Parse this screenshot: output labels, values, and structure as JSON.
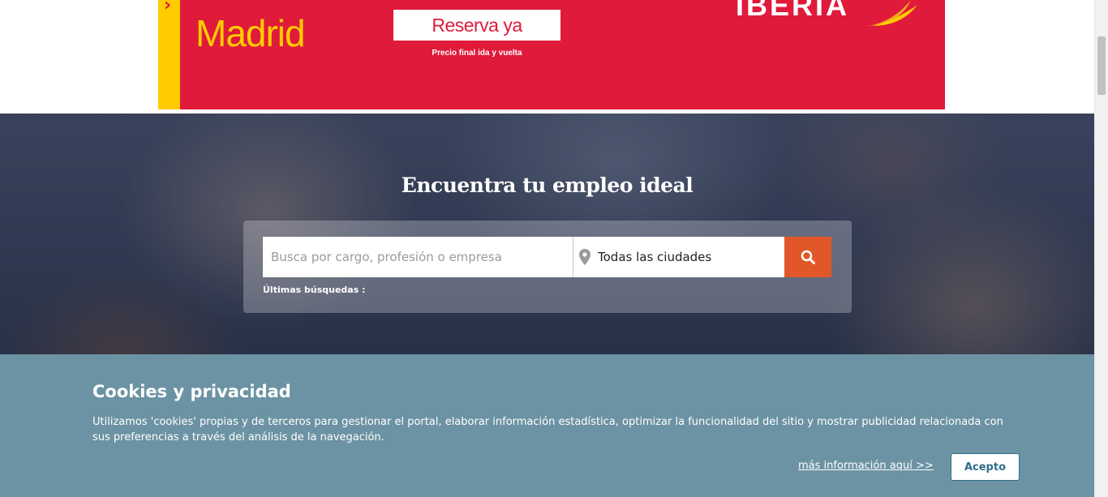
{
  "ad": {
    "chevron": "›",
    "city": "Madrid",
    "cta": "Reserva ya",
    "note": "Precio final ida y vuelta",
    "brand": "IBERIA",
    "colors": {
      "background": "#e01a3b",
      "accent": "#ffcc00"
    }
  },
  "hero": {
    "title": "Encuentra tu empleo ideal",
    "search": {
      "placeholder": "Busca por cargo, profesión o empresa",
      "value": "",
      "city_value": "Todas las ciudades",
      "city_icon": "map-pin-icon",
      "button_icon": "search-icon"
    },
    "recent_label": "Últimas búsquedas :"
  },
  "cookies": {
    "title": "Cookies y privacidad",
    "text": "Utilizamos 'cookies' propias y de terceros para gestionar el portal, elaborar información estadística, optimizar la funcionalidad del sitio y mostrar publicidad relacionada con sus preferencias a través del análisis de la navegación.",
    "more_link": "más información aquí >>",
    "accept": "Acepto"
  },
  "colors": {
    "search_button": "#e2572a",
    "cookie_bar": "#6c93a3",
    "accept_border": "#2f6d8a"
  }
}
